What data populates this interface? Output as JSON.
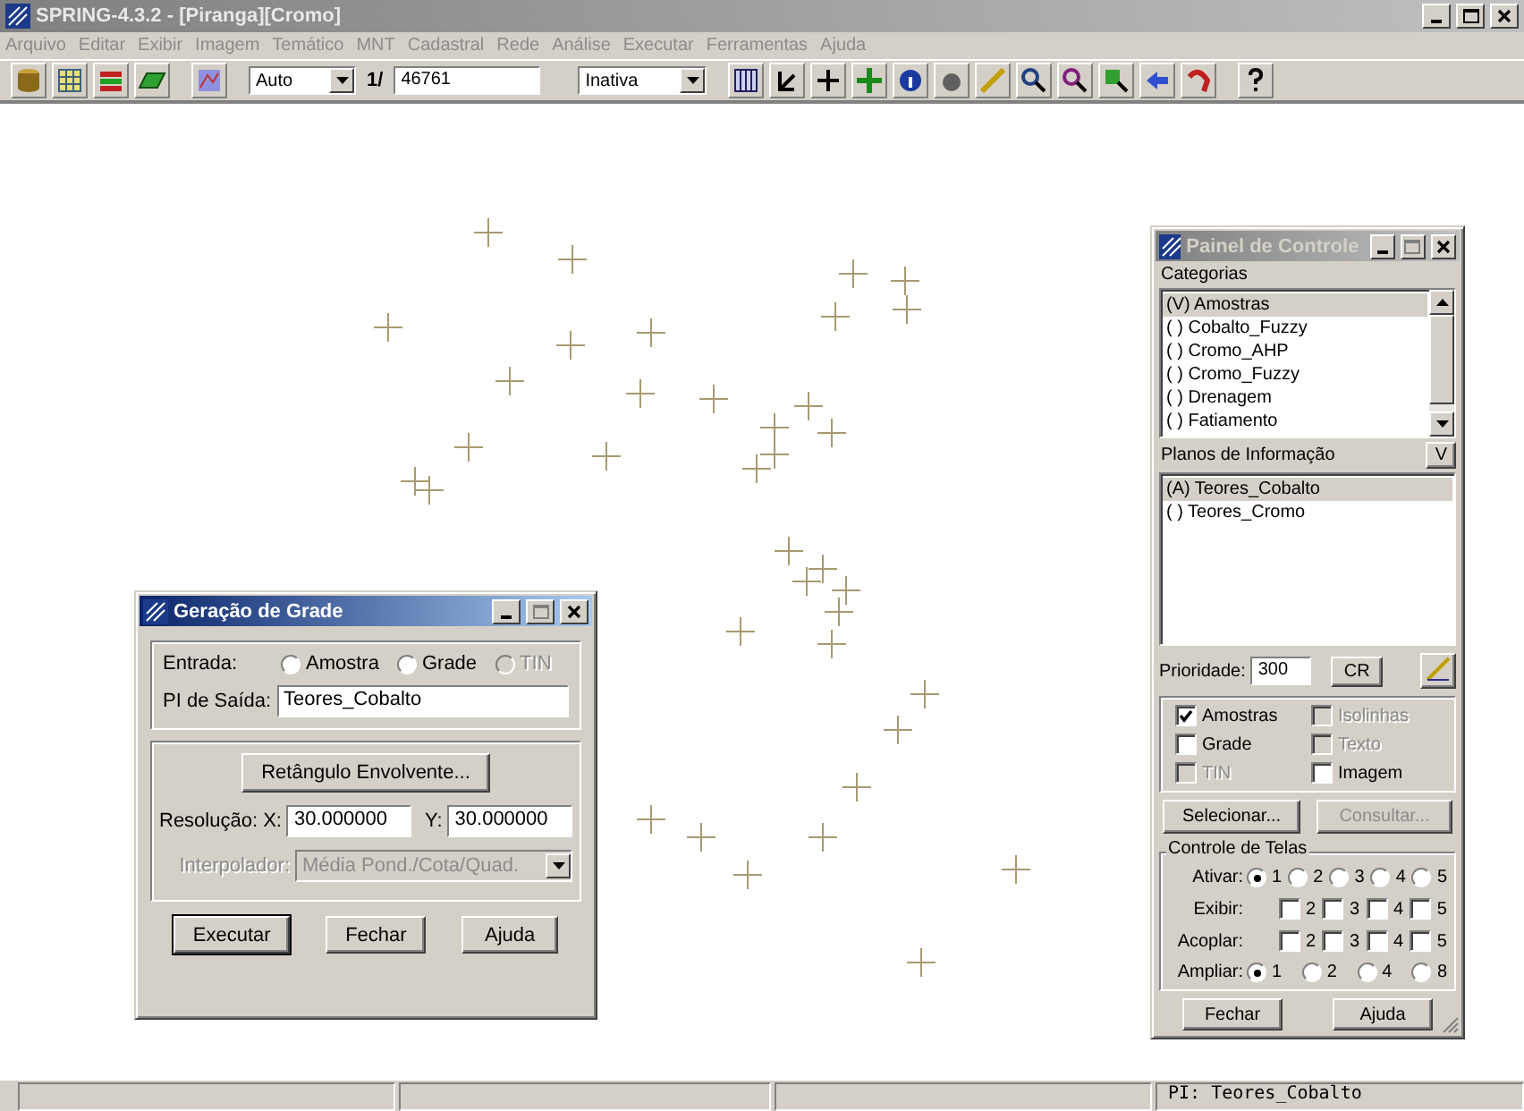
{
  "window": {
    "title": "SPRING-4.3.2 - [Piranga][Cromo]"
  },
  "menu": [
    "Arquivo",
    "Editar",
    "Exibir",
    "Imagem",
    "Temático",
    "MNT",
    "Cadastral",
    "Rede",
    "Análise",
    "Executar",
    "Ferramentas",
    "Ajuda"
  ],
  "toolbar": {
    "mode_select": "Auto",
    "page_label": "1/",
    "page_field": "46761",
    "state_select": "Inativa"
  },
  "grid_dialog": {
    "title": "Geração de Grade",
    "input_label": "Entrada:",
    "input_options": [
      {
        "label": "Amostra",
        "selected": false,
        "disabled": false
      },
      {
        "label": "Grade",
        "selected": false,
        "disabled": false
      },
      {
        "label": "TIN",
        "selected": false,
        "disabled": true
      }
    ],
    "output_label": "PI de Saída:",
    "output_value": "Teores_Cobalto",
    "bounds_button": "Retângulo Envolvente...",
    "resolution_label": "Resolução: X:",
    "x_value": "30.000000",
    "y_label": "Y:",
    "y_value": "30.000000",
    "interpolator_label": "Interpolador:",
    "interpolator_value": "Média Pond./Cota/Quad.",
    "interpolator_disabled": true,
    "buttons": [
      "Executar",
      "Fechar",
      "Ajuda"
    ]
  },
  "control_panel": {
    "title": "Painel de Controle",
    "categories_label": "Categorias",
    "categories": [
      {
        "label": "(V) Amostras",
        "selected": true
      },
      {
        "label": "( ) Cobalto_Fuzzy",
        "selected": false
      },
      {
        "label": "( ) Cromo_AHP",
        "selected": false
      },
      {
        "label": "( ) Cromo_Fuzzy",
        "selected": false
      },
      {
        "label": "( ) Drenagem",
        "selected": false
      },
      {
        "label": "( ) Fatiamento",
        "selected": false
      }
    ],
    "planes_label": "Planos de Informação",
    "planes_button": "V",
    "planes": [
      {
        "label": "(A) Teores_Cobalto",
        "selected": true
      },
      {
        "label": "( ) Teores_Cromo",
        "selected": false
      }
    ],
    "priority_label": "Prioridade:",
    "priority_value": "300",
    "cr_button": "CR",
    "layers": [
      {
        "label": "Amostras",
        "checked": true,
        "disabled": false
      },
      {
        "label": "Isolinhas",
        "checked": false,
        "disabled": true
      },
      {
        "label": "Grade",
        "checked": false,
        "disabled": false
      },
      {
        "label": "Texto",
        "checked": false,
        "disabled": true
      },
      {
        "label": "TIN",
        "checked": false,
        "disabled": true
      },
      {
        "label": "Imagem",
        "checked": false,
        "disabled": false
      }
    ],
    "select_button": {
      "label": "Selecionar...",
      "disabled": false
    },
    "query_button": {
      "label": "Consultar...",
      "disabled": true
    },
    "screens_label": "Controle de Telas",
    "screen_rows": [
      {
        "label": "Ativar:",
        "kind": "radio",
        "options": [
          {
            "label": "1",
            "selected": true
          },
          {
            "label": "2",
            "selected": false
          },
          {
            "label": "3",
            "selected": false
          },
          {
            "label": "4",
            "selected": false
          },
          {
            "label": "5",
            "selected": false
          }
        ]
      },
      {
        "label": "Exibir:",
        "kind": "checkbox",
        "options": [
          {
            "label": "2",
            "checked": false
          },
          {
            "label": "3",
            "checked": false
          },
          {
            "label": "4",
            "checked": false
          },
          {
            "label": "5",
            "checked": false
          }
        ]
      },
      {
        "label": "Acoplar:",
        "kind": "checkbox",
        "options": [
          {
            "label": "2",
            "checked": false
          },
          {
            "label": "3",
            "checked": false
          },
          {
            "label": "4",
            "checked": false
          },
          {
            "label": "5",
            "checked": false
          }
        ]
      },
      {
        "label": "Ampliar:",
        "kind": "radio",
        "options": [
          {
            "label": "1",
            "selected": true
          },
          {
            "label": "2",
            "selected": false
          },
          {
            "label": "4",
            "selected": false
          },
          {
            "label": "8",
            "selected": false
          }
        ]
      }
    ],
    "buttons": [
      "Fechar",
      "Ajuda"
    ]
  },
  "status_bar": {
    "text": "PI: Teores_Cobalto"
  }
}
